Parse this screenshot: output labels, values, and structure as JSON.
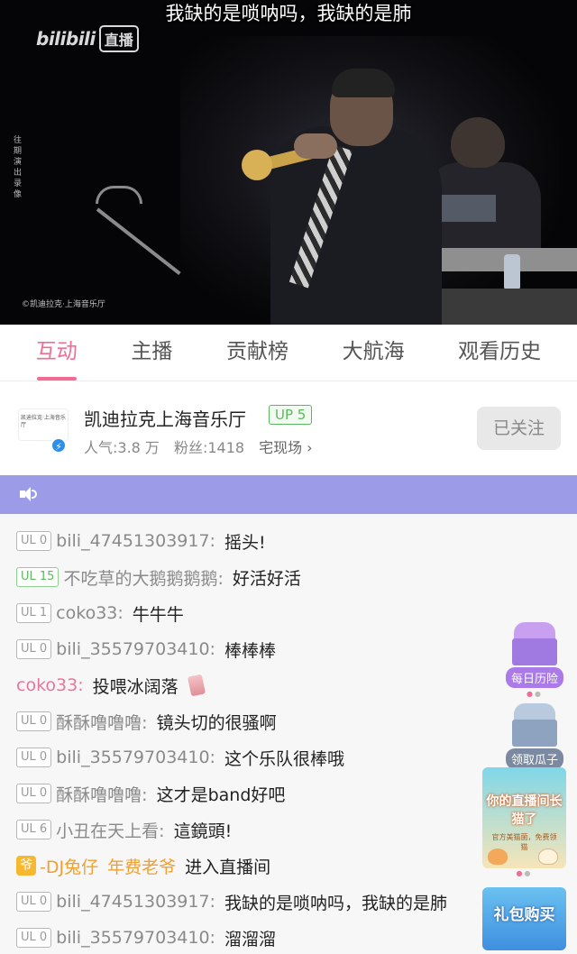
{
  "video": {
    "subtitle": "我缺的是唢呐吗，我缺的是肺",
    "logo_text": "bilibili",
    "logo_badge": "直播",
    "side_note": "往期演出录像",
    "copyright": "©凯迪拉克·上海音乐厅"
  },
  "tabs": [
    {
      "label": "互动",
      "active": true
    },
    {
      "label": "主播",
      "active": false
    },
    {
      "label": "贡献榜",
      "active": false
    },
    {
      "label": "大航海",
      "active": false
    },
    {
      "label": "观看历史",
      "active": false
    }
  ],
  "streamer": {
    "avatar_text": "凯迪拉克·上海音乐厅",
    "name": "凯迪拉克上海音乐厅",
    "level": "UP 5",
    "popularity": "人气:3.8 万",
    "fans": "粉丝:1418",
    "link": "宅现场",
    "follow_label": "已关注"
  },
  "chat": [
    {
      "ul": "UL 0",
      "user": "bili_47451303917:",
      "msg": "摇头!"
    },
    {
      "ul": "UL 15",
      "user": "不吃草的大鹅鹅鹅鹅:",
      "msg": "好活好活"
    },
    {
      "ul": "UL 1",
      "user": "coko33:",
      "msg": "牛牛牛"
    },
    {
      "ul": "UL 0",
      "user": "bili_35579703410:",
      "msg": "棒棒棒"
    },
    {
      "user": "coko33:",
      "msg": "投喂冰阔落"
    },
    {
      "ul": "UL 0",
      "user": "酥酥噜噜噜:",
      "msg": "镜头切的很骚啊"
    },
    {
      "ul": "UL 0",
      "user": "bili_35579703410:",
      "msg": "这个乐队很棒哦"
    },
    {
      "ul": "UL 0",
      "user": "酥酥噜噜噜:",
      "msg": "这才是band好吧"
    },
    {
      "ul": "UL 6",
      "user": "小丑在天上看:",
      "msg": "這鏡頭!"
    },
    {
      "badge": "爷",
      "user": "-DJ兔仔",
      "title": "年费老爷",
      "msg": "进入直播间"
    },
    {
      "ul": "UL 0",
      "user": "bili_47451303917:",
      "msg": "我缺的是唢呐吗，我缺的是肺"
    },
    {
      "ul": "UL 0",
      "user": "bili_35579703410:",
      "msg": "溜溜溜"
    }
  ],
  "widgets": {
    "daily": "每日历险",
    "melon": "领取瓜子",
    "banner1_title": "你的直播间长猫了",
    "banner1_sub": "官方美猫菌，免费领猫",
    "banner2_title": "礼包购买"
  },
  "colors": {
    "accent": "#f06c93",
    "notice_bar": "#9b9be8",
    "level_green": "#5cb85c",
    "vip_orange": "#f0a030"
  }
}
